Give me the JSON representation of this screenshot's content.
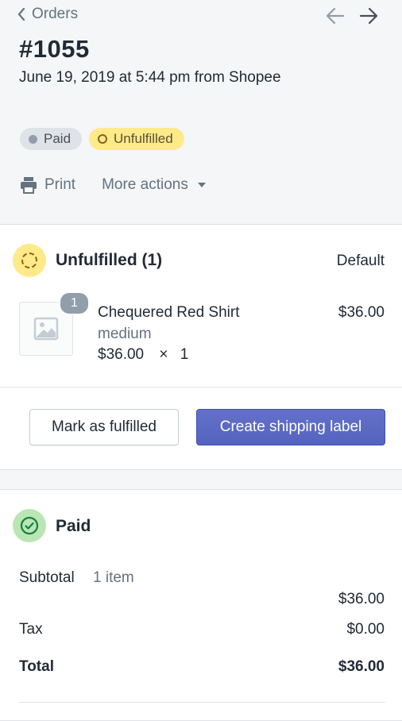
{
  "header": {
    "back_label": "Orders",
    "order_number": "#1055",
    "order_meta": "June 19, 2019 at 5:44 pm from Shopee",
    "badges": {
      "paid": "Paid",
      "unfulfilled": "Unfulfilled"
    },
    "print_label": "Print",
    "more_actions_label": "More actions"
  },
  "unfulfilled_card": {
    "title": "Unfulfilled (1)",
    "location": "Default",
    "item": {
      "quantity_badge": "1",
      "name": "Chequered Red Shirt",
      "variant": "medium",
      "unit_price": "$36.00",
      "times": "×",
      "quantity": "1",
      "line_total": "$36.00"
    },
    "mark_fulfilled_label": "Mark as fulfilled",
    "create_label_label": "Create shipping label"
  },
  "paid_card": {
    "title": "Paid",
    "subtotal_label": "Subtotal",
    "subtotal_items": "1 item",
    "subtotal_value": "$36.00",
    "tax_label": "Tax",
    "tax_value": "$0.00",
    "total_label": "Total",
    "total_value": "$36.00"
  },
  "colors": {
    "primary": "#5c6ac4",
    "unfulfilled_badge": "#ffea8a",
    "paid_badge": "#dfe3e8",
    "paid_circle": "#bbe5b3",
    "paid_check": "#108043"
  }
}
